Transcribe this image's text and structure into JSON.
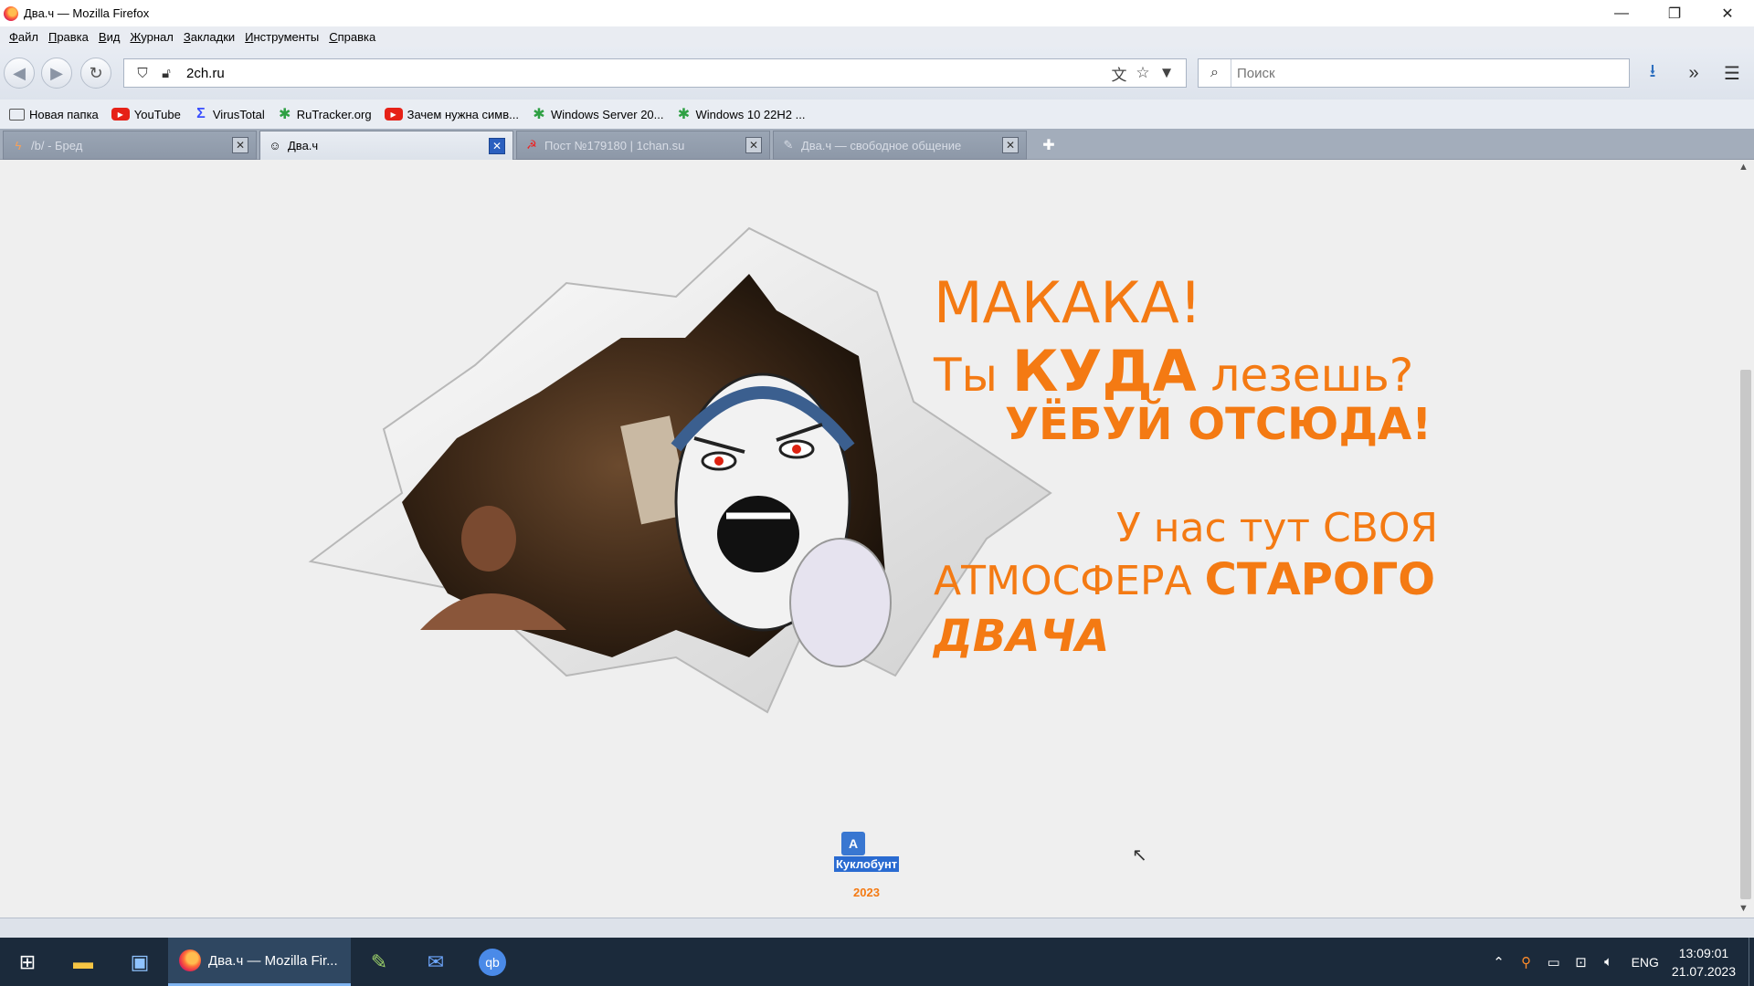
{
  "window": {
    "title": "Два.ч — Mozilla Firefox"
  },
  "menu": [
    {
      "key": "Ф",
      "rest": "айл"
    },
    {
      "key": "П",
      "rest": "равка"
    },
    {
      "key": "В",
      "rest": "ид"
    },
    {
      "key": "Ж",
      "rest": "урнал"
    },
    {
      "key": "З",
      "rest": "акладки"
    },
    {
      "key": "И",
      "rest": "нструменты"
    },
    {
      "key": "С",
      "rest": "правка"
    }
  ],
  "nav": {
    "url": "2ch.ru",
    "search_placeholder": "Поиск"
  },
  "bookmarks": [
    {
      "label": "Новая папка",
      "icon": "folder-icon"
    },
    {
      "label": "YouTube",
      "icon": "youtube-icon"
    },
    {
      "label": "VirusTotal",
      "icon": "virustotal-icon"
    },
    {
      "label": "RuTracker.org",
      "icon": "rutracker-icon"
    },
    {
      "label": "Зачем нужна симв...",
      "icon": "youtube-icon"
    },
    {
      "label": "Windows Server 20...",
      "icon": "rutracker-icon"
    },
    {
      "label": "Windows 10 22H2 ...",
      "icon": "rutracker-icon"
    }
  ],
  "tabs": [
    {
      "label": "/b/ - Бред",
      "active": false
    },
    {
      "label": "Два.ч",
      "active": true
    },
    {
      "label": "Пост №179180 | 1chan.su",
      "active": false
    },
    {
      "label": "Два.ч — свободное общение",
      "active": false
    }
  ],
  "banner": {
    "line1": "МАКАКА!",
    "line2_a": "Ты ",
    "line2_b": "КУДА",
    "line2_c": " лезешь?",
    "line3": "УЁБУЙ ОТСЮДА!",
    "line4": "У нас тут СВОЯ",
    "line5_a": "АТМОСФЕРА ",
    "line5_b": "СТАРОГО",
    "line6": "ДВАЧА"
  },
  "footer": {
    "link": "Куклобунт",
    "year": "2023"
  },
  "taskbar": {
    "active_app": "Два.ч — Mozilla Fir...",
    "lang": "ENG",
    "time": "13:09:01",
    "date": "21.07.2023"
  }
}
